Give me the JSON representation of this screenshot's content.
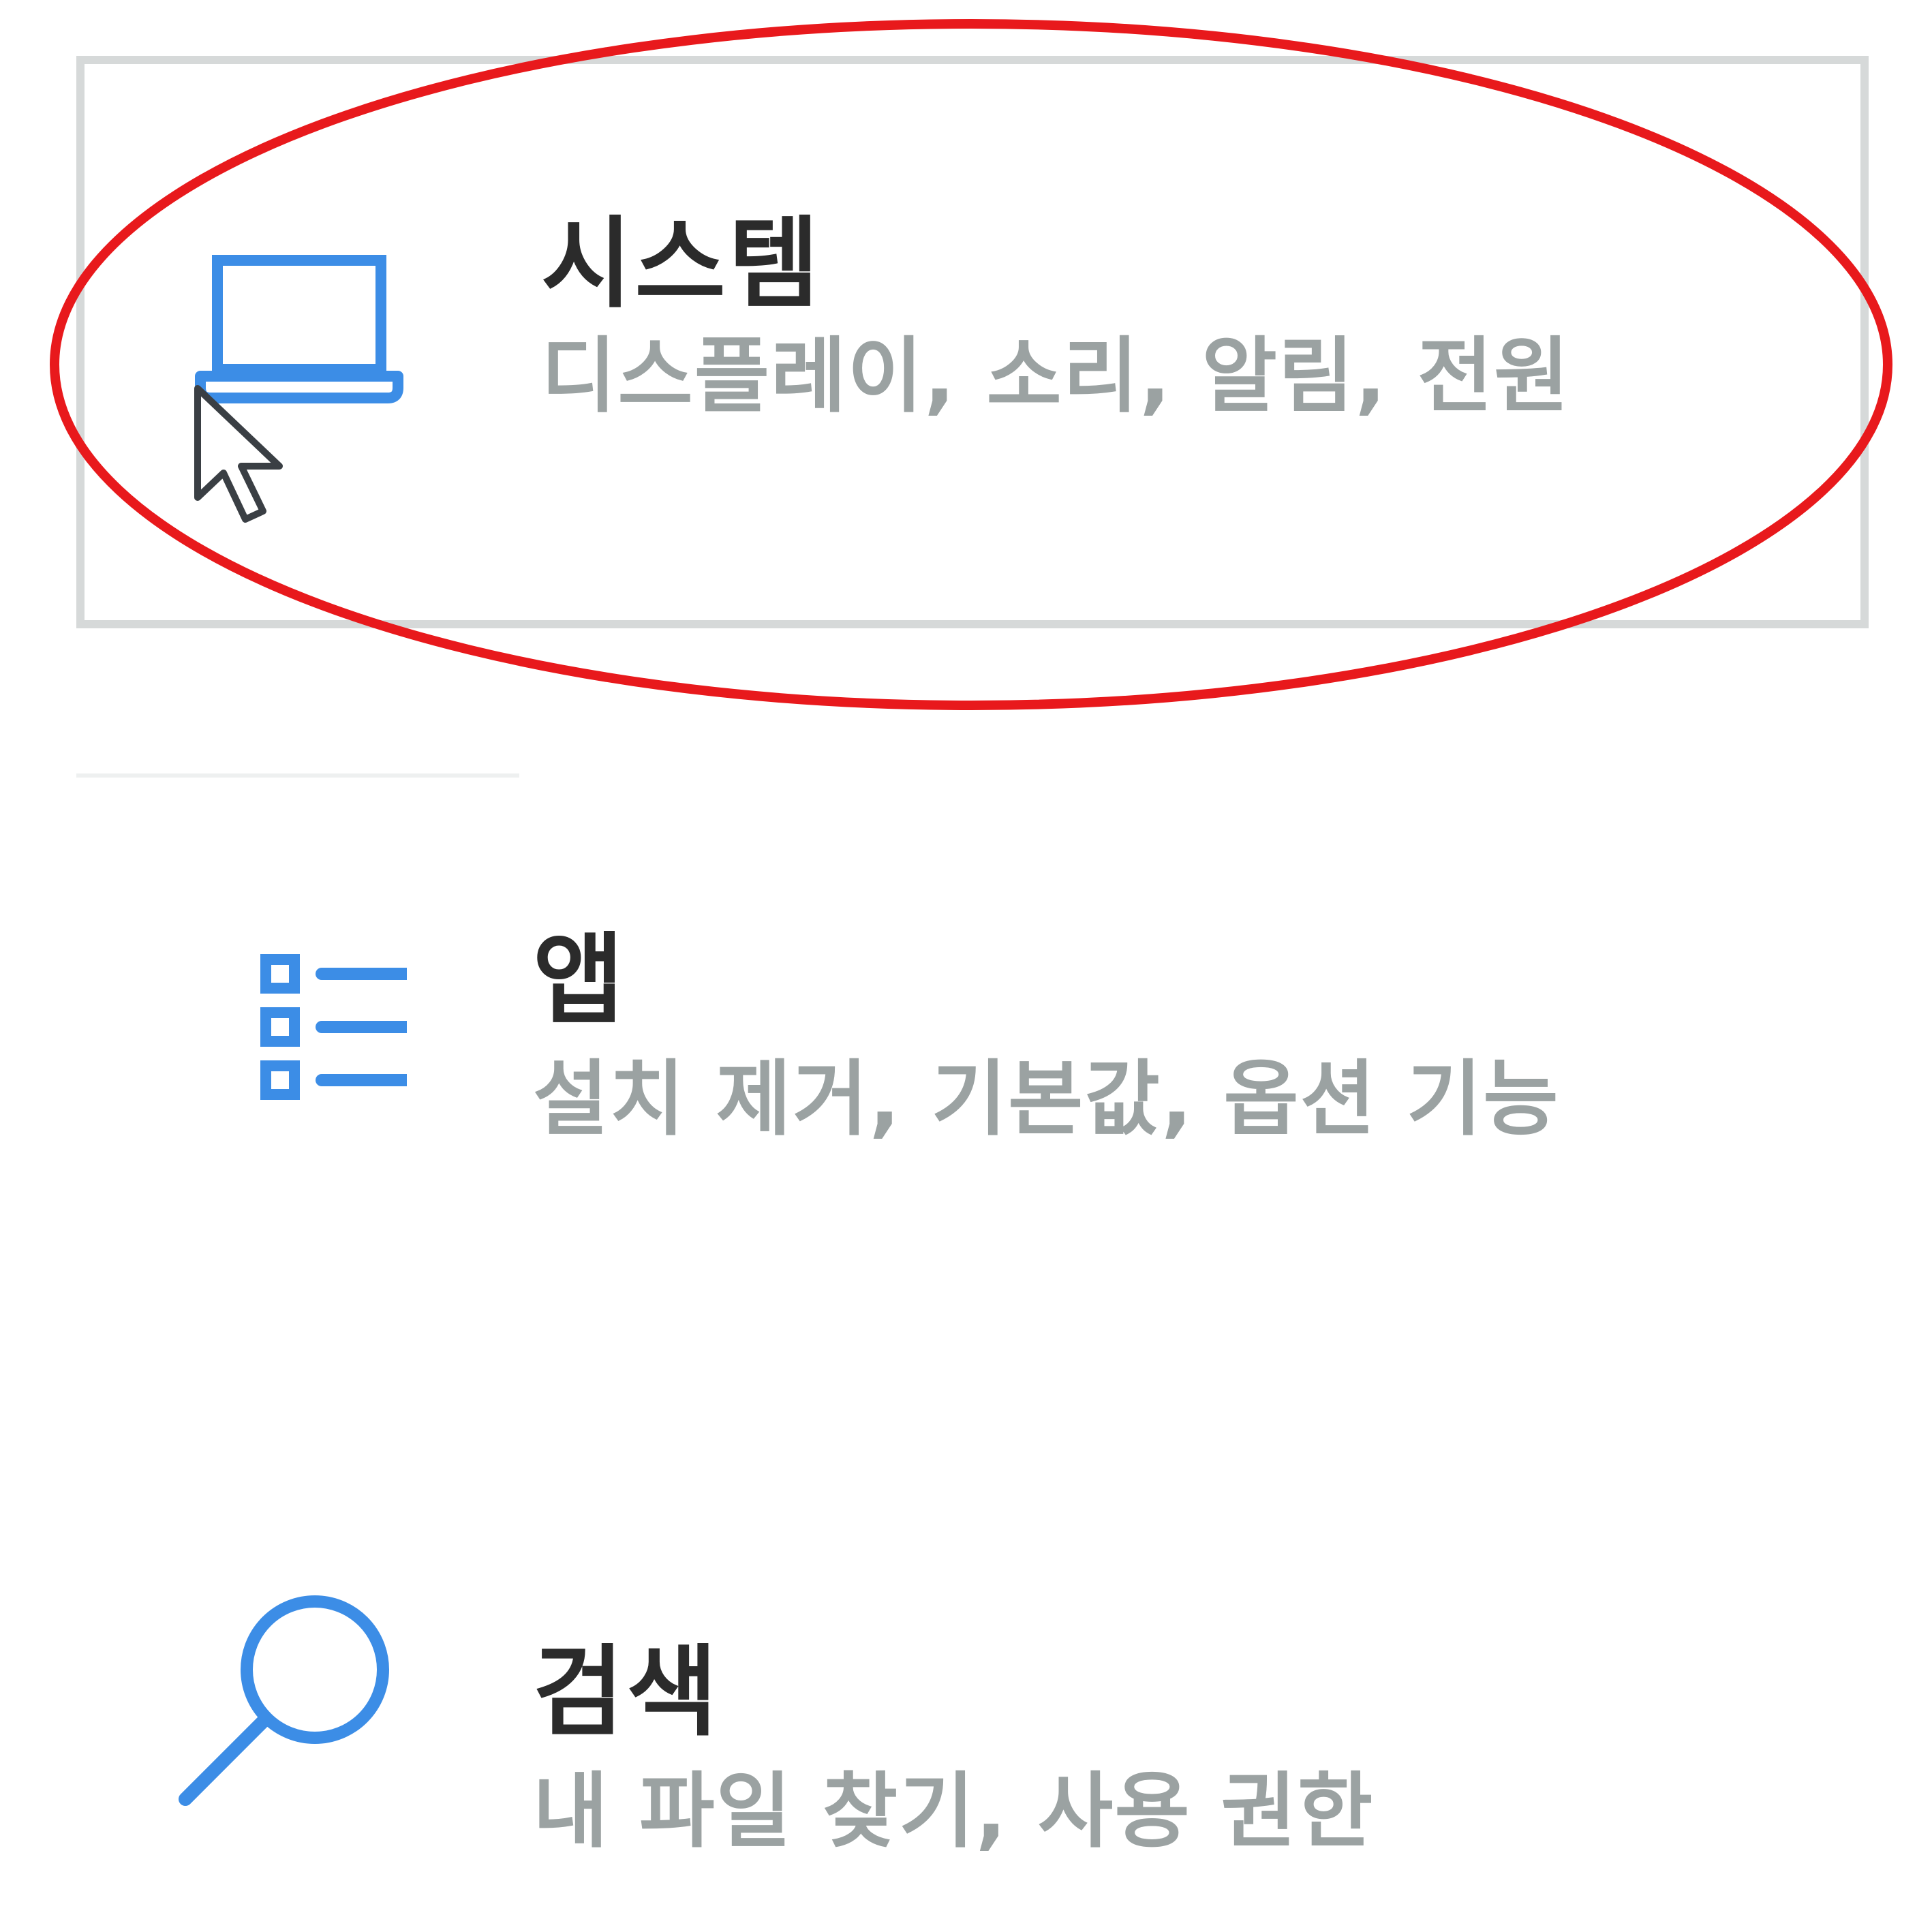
{
  "settings_tiles": [
    {
      "title": "시스템",
      "description": "디스플레이, 소리, 알림, 전원",
      "icon": "laptop-icon",
      "state": "hovered"
    },
    {
      "title": "앱",
      "description": "설치 제거, 기본값, 옵션 기능",
      "icon": "app-list-icon",
      "state": "normal"
    },
    {
      "title": "검색",
      "description": "내 파일 찾기, 사용 권한",
      "icon": "search-icon",
      "state": "normal"
    }
  ],
  "cursor": {
    "icon": "mouse-pointer-icon"
  },
  "annotation": {
    "shape": "ellipse",
    "color": "#e8191c",
    "target": "시스템"
  },
  "colors": {
    "icon_accent": "#3c8de6",
    "title_text": "#2b2b2b",
    "description_text": "#9ba2a2",
    "hover_border": "#d6d9d9"
  }
}
